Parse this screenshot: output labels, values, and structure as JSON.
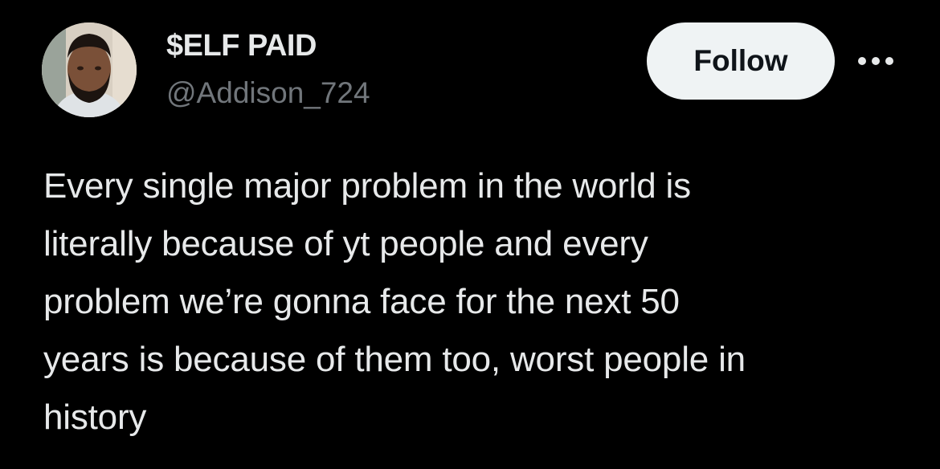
{
  "author": {
    "display_name": "$ELF PAID",
    "handle": "@Addison_724",
    "avatar_icon": "profile-photo"
  },
  "actions": {
    "follow_label": "Follow",
    "more_icon": "more-options-icon"
  },
  "tweet": {
    "text": "Every single major problem in the world is\nliterally because of yt people and every\nproblem we’re gonna face for the next 50\nyears is because of them too, worst people in\nhistory"
  },
  "colors": {
    "background": "#000000",
    "primary_text": "#e7e9ea",
    "secondary_text": "#71767b",
    "follow_button_bg": "#eff3f4",
    "follow_button_text": "#0f1419"
  }
}
